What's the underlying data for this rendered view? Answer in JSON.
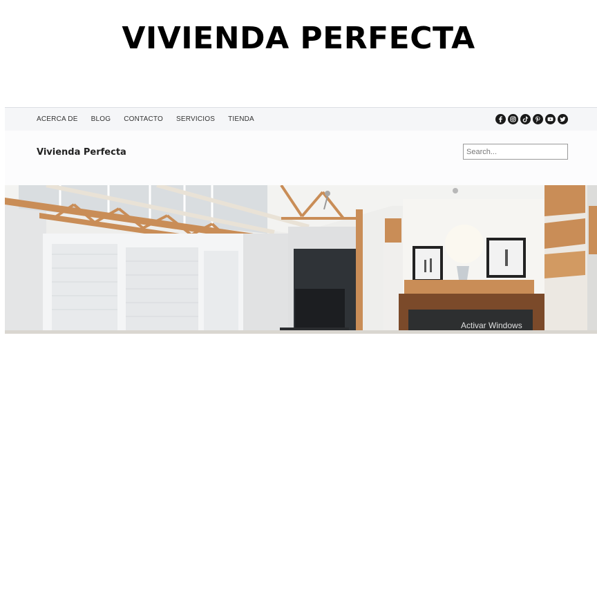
{
  "headline": "VIVIENDA PERFECTA",
  "nav": {
    "items": [
      "ACERCA DE",
      "BLOG",
      "CONTACTO",
      "SERVICIOS",
      "TIENDA"
    ]
  },
  "socials": [
    "facebook-icon",
    "instagram-icon",
    "tiktok-icon",
    "pinterest-icon",
    "youtube-icon",
    "twitter-icon"
  ],
  "brand": {
    "name": "Vivienda Perfecta"
  },
  "search": {
    "placeholder": "Search..."
  },
  "hero": {
    "watermark": "Activar Windows"
  }
}
